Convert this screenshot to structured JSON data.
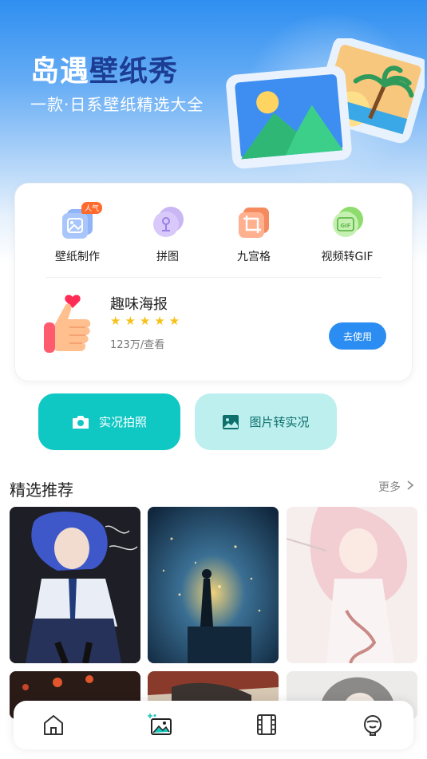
{
  "hero": {
    "title_part1": "岛遇",
    "title_part2": "壁纸秀",
    "subtitle": "一款·日系壁纸精选大全"
  },
  "tools": [
    {
      "label": "壁纸制作",
      "badge": "人气",
      "icon": "wallpaper-make-icon"
    },
    {
      "label": "拼图",
      "icon": "puzzle-icon"
    },
    {
      "label": "九宫格",
      "icon": "crop-grid-icon"
    },
    {
      "label": "视频转GIF",
      "icon": "gif-icon"
    }
  ],
  "poster": {
    "title": "趣味海报",
    "stars": "★★★★★",
    "views": "123万/查看",
    "button": "去使用"
  },
  "actions": {
    "live_photo": "实况拍照",
    "image_to_live": "图片转实况"
  },
  "featured": {
    "title": "精选推荐",
    "more": "更多"
  },
  "colors": {
    "accent_blue": "#2b8df1",
    "teal": "#0fc8c4",
    "teal_light": "#bcefee",
    "star": "#f6c21a"
  },
  "nav": [
    "home-icon",
    "wallpaper-icon",
    "video-icon",
    "profile-icon"
  ]
}
